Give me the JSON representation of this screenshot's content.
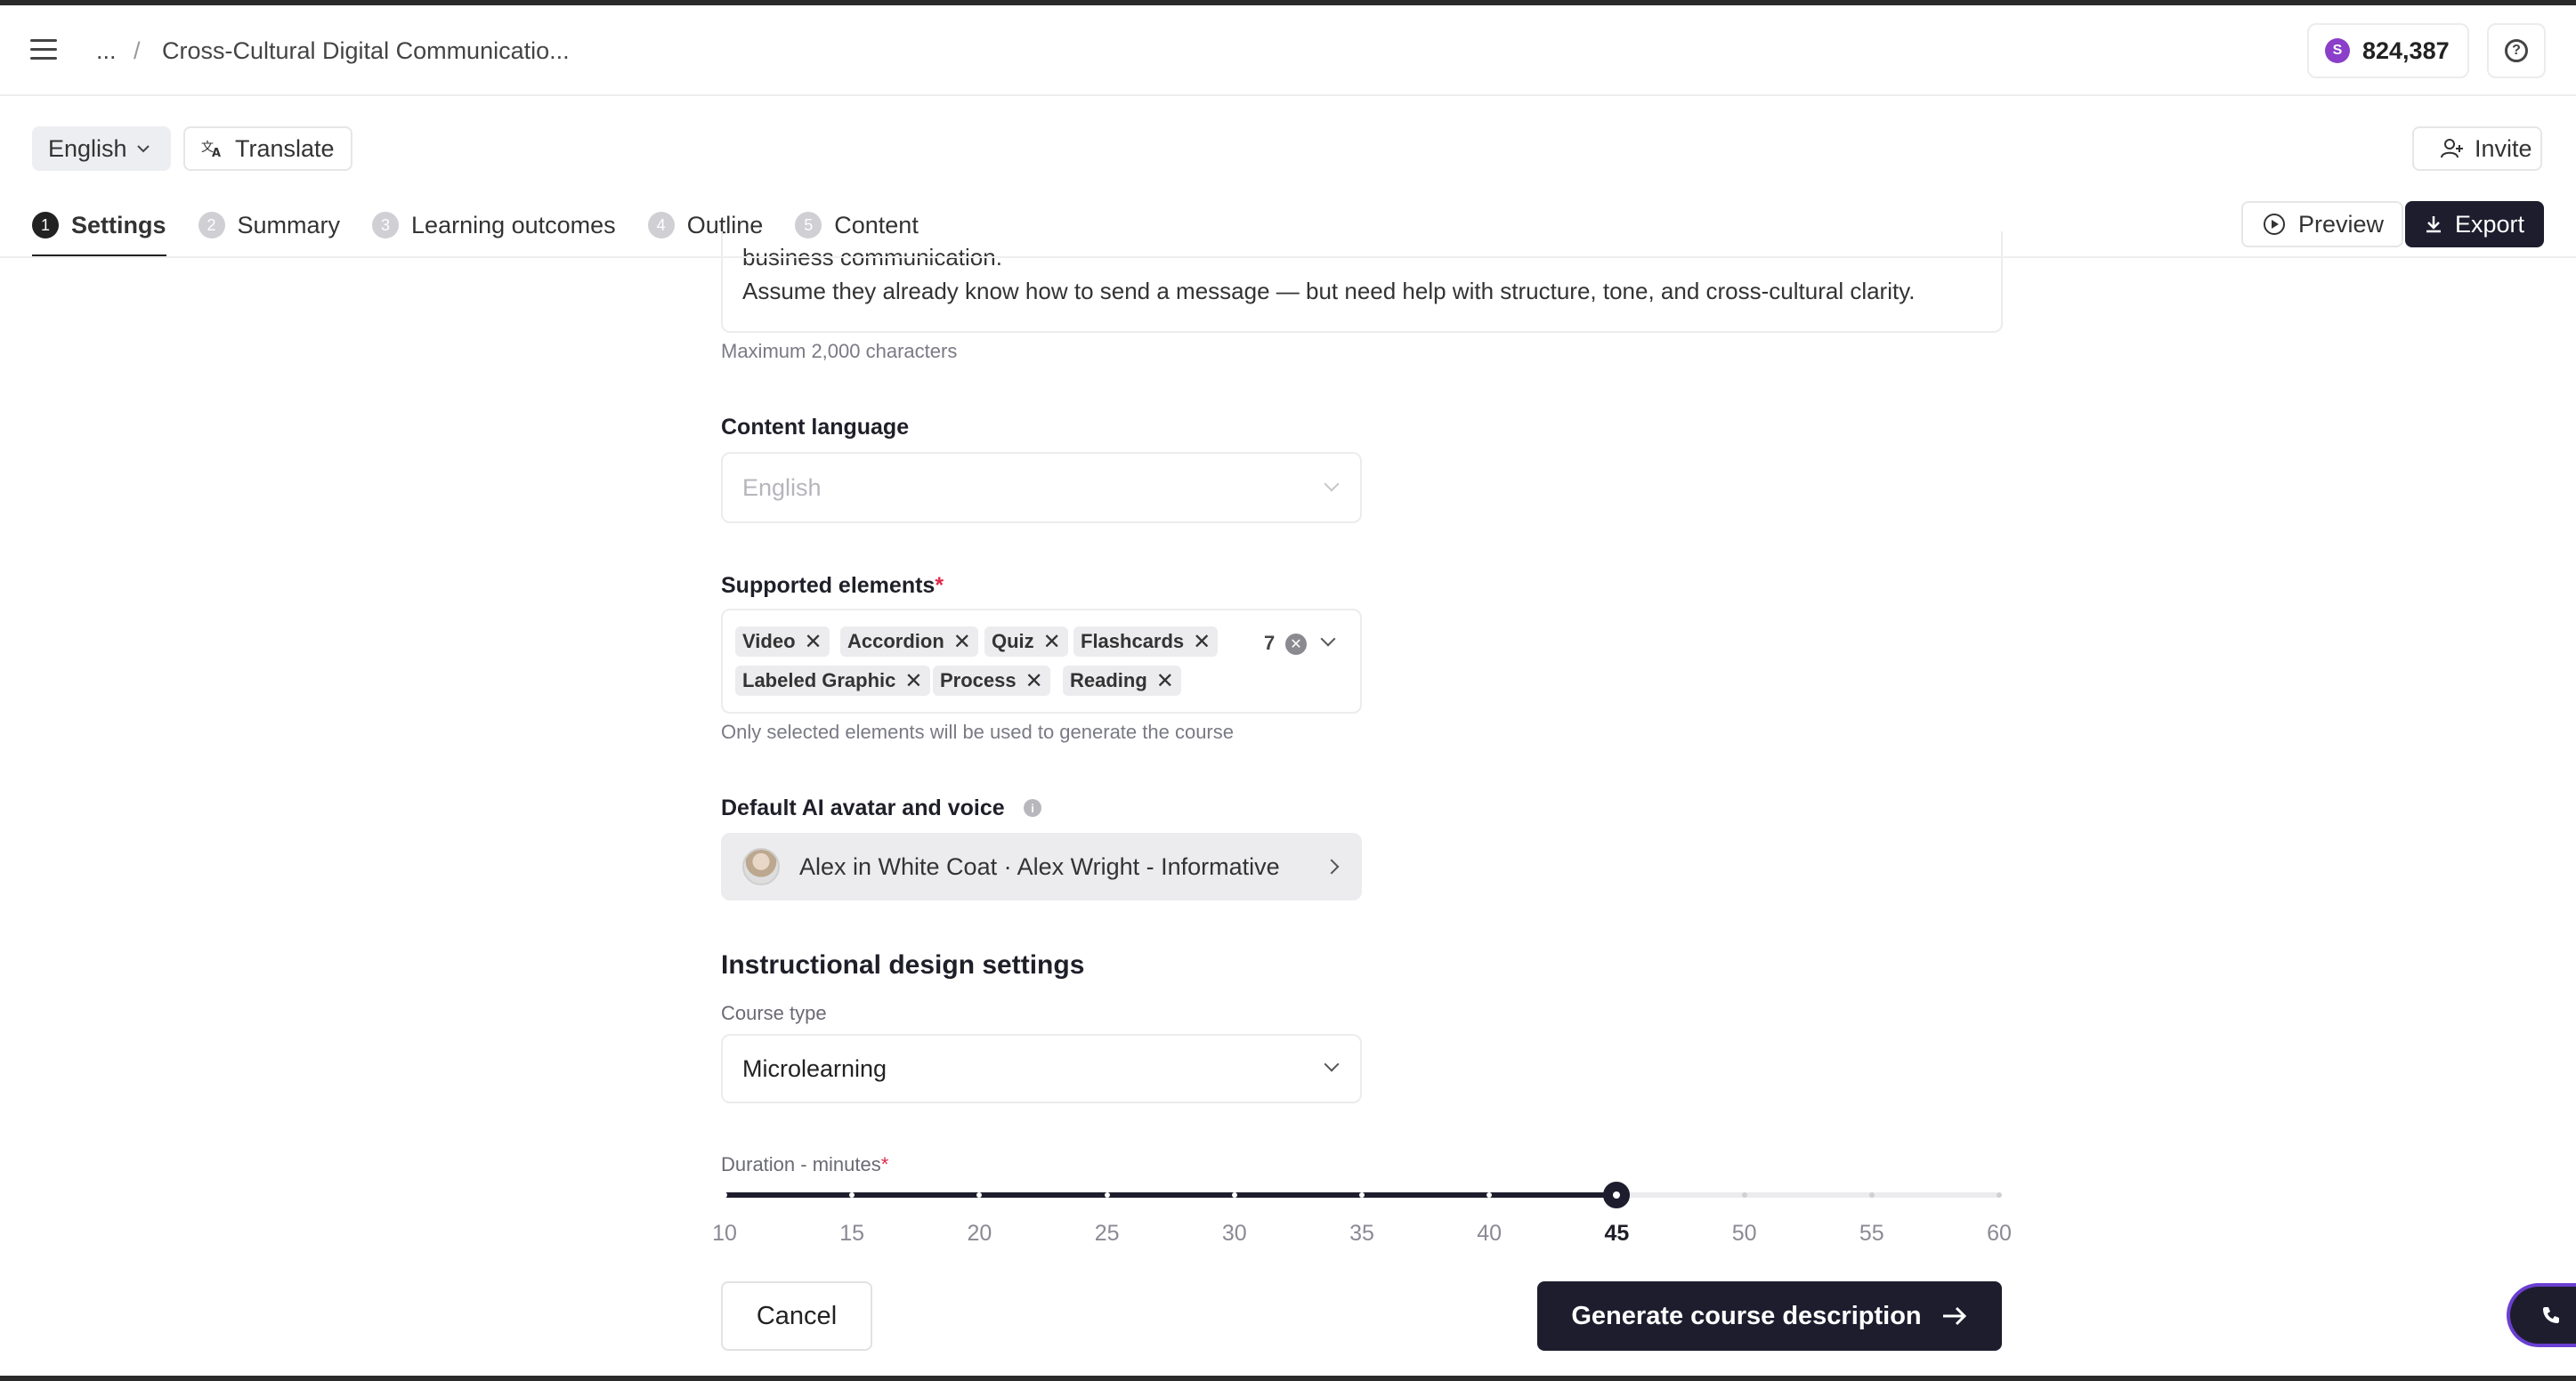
{
  "breadcrumb": {
    "ellipsis": "...",
    "separator": "/",
    "title": "Cross-Cultural Digital Communicatio..."
  },
  "credits": {
    "icon_letter": "S",
    "amount": "824,387"
  },
  "language_button": {
    "label": "English"
  },
  "translate_button": {
    "label": "Translate"
  },
  "invite_button": {
    "label": "Invite"
  },
  "steps": [
    {
      "num": "1",
      "label": "Settings",
      "active": true
    },
    {
      "num": "2",
      "label": "Summary",
      "active": false
    },
    {
      "num": "3",
      "label": "Learning outcomes",
      "active": false
    },
    {
      "num": "4",
      "label": "Outline",
      "active": false
    },
    {
      "num": "5",
      "label": "Content",
      "active": false
    }
  ],
  "preview_button": {
    "label": "Preview"
  },
  "export_button": {
    "label": "Export"
  },
  "audience": {
    "line1": "business communication.",
    "line2": "Assume they already know how to send a message — but need help with structure, tone, and cross-cultural clarity.",
    "helper": "Maximum 2,000 characters"
  },
  "content_language": {
    "label": "Content language",
    "value": "English"
  },
  "supported_elements": {
    "label": "Supported elements",
    "required_mark": "*",
    "tags": [
      "Video",
      "Accordion",
      "Quiz",
      "Flashcards",
      "Labeled Graphic",
      "Process",
      "Reading"
    ],
    "count": "7",
    "helper": "Only selected elements will be used to generate the course"
  },
  "avatar": {
    "label": "Default AI avatar and voice",
    "value": "Alex in White Coat · Alex Wright - Informative"
  },
  "instructional": {
    "title": "Instructional design settings",
    "course_type_label": "Course type",
    "course_type_value": "Microlearning"
  },
  "duration": {
    "label": "Duration - minutes",
    "required_mark": "*",
    "ticks": [
      "10",
      "15",
      "20",
      "25",
      "30",
      "35",
      "40",
      "45",
      "50",
      "55",
      "60"
    ],
    "selected": 45,
    "min": 10,
    "max": 60
  },
  "buttons": {
    "cancel": "Cancel",
    "generate": "Generate course description"
  },
  "colors": {
    "primary": "#1e1d2e",
    "required": "#e0294b",
    "credit": "#8b3ec9"
  }
}
